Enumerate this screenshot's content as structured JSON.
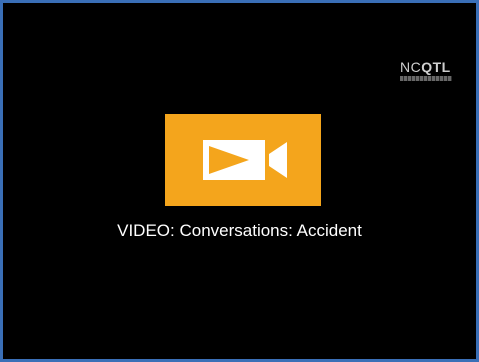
{
  "slide": {
    "logo": {
      "text_light": "NC",
      "text_bold": "QTL"
    },
    "video_icon": {
      "name": "video-camera-icon",
      "background_color": "#f4a51c",
      "glyph_color": "#ffffff"
    },
    "caption": "VIDEO: Conversations: Accident"
  },
  "colors": {
    "background": "#000000",
    "border": "#3a6fb7"
  }
}
